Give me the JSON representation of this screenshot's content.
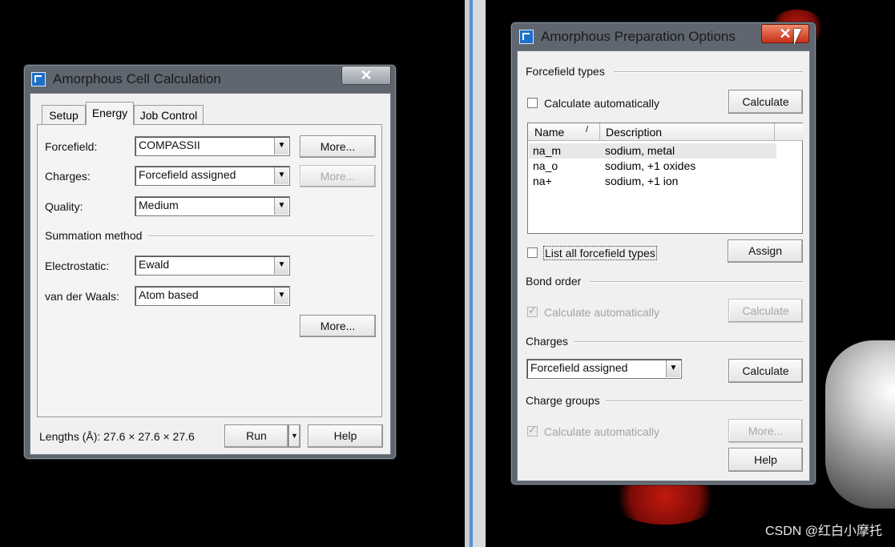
{
  "left_dialog": {
    "title": "Amorphous Cell Calculation",
    "close": "✕",
    "tabs": [
      "Setup",
      "Energy",
      "Job Control"
    ],
    "active_tab": "Energy",
    "forcefield_label": "Forcefield:",
    "forcefield_value": "COMPASSII",
    "charges_label": "Charges:",
    "charges_value": "Forcefield assigned",
    "quality_label": "Quality:",
    "quality_value": "Medium",
    "summation_label": "Summation method",
    "electrostatic_label": "Electrostatic:",
    "electrostatic_value": "Ewald",
    "vdw_label": "van der Waals:",
    "vdw_value": "Atom based",
    "more_label": "More...",
    "lengths_text": "Lengths (Å): 27.6 × 27.6 × 27.6",
    "run_label": "Run",
    "help_label": "Help"
  },
  "right_dialog": {
    "title": "Amorphous Preparation Options",
    "close": "✕",
    "ff_types_section": "Forcefield types",
    "calc_auto_label": "Calculate automatically",
    "calculate_label": "Calculate",
    "columns": [
      "Name",
      "Description"
    ],
    "sort_indicator": "/",
    "rows": [
      {
        "name": "na_m",
        "desc": "sodium, metal"
      },
      {
        "name": "na_o",
        "desc": "sodium, +1 oxides"
      },
      {
        "name": "na+",
        "desc": "sodium, +1 ion"
      }
    ],
    "list_all_label": "List all forcefield types",
    "assign_label": "Assign",
    "bond_order_section": "Bond order",
    "charges_section": "Charges",
    "charges_value": "Forcefield assigned",
    "charge_groups_section": "Charge groups",
    "more_label": "More...",
    "help_label": "Help",
    "check_mark": "✓"
  },
  "watermark": "CSDN @红白小摩托",
  "colors": {
    "desktop": "#000000",
    "dialog_bg": "#f0f0f0",
    "frame": "#5f6670"
  }
}
